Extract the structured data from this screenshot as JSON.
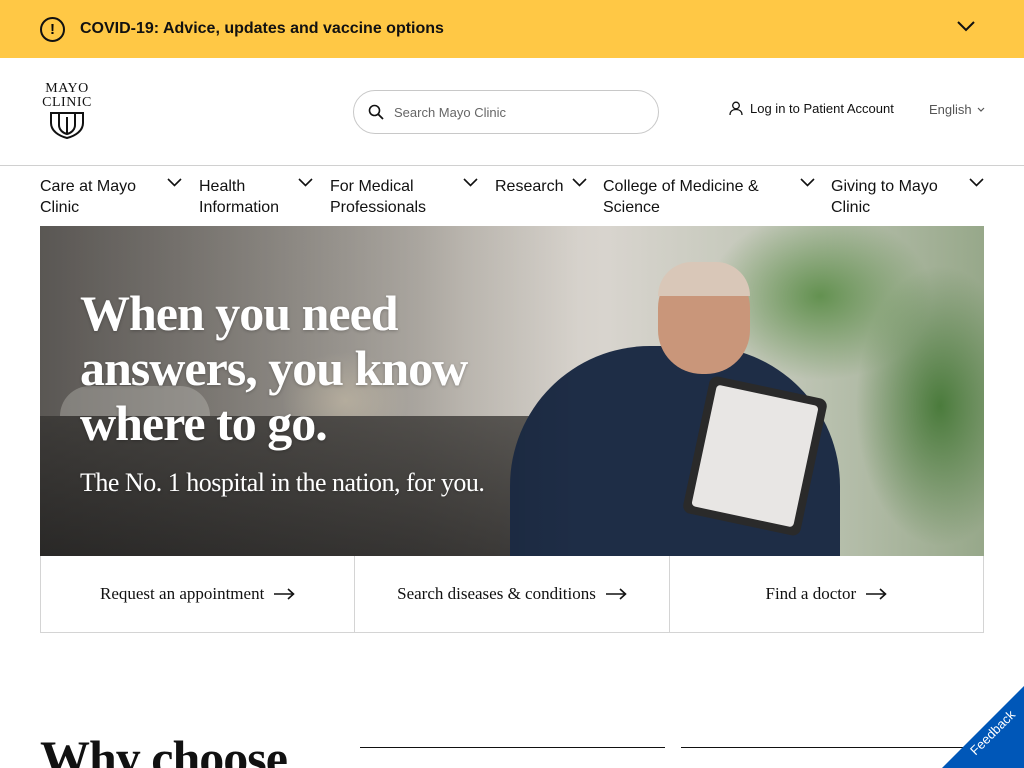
{
  "alert": {
    "icon": "exclamation-icon",
    "text": "COVID-19: Advice, updates and vaccine options",
    "accent": "#ffc845"
  },
  "header": {
    "logo": {
      "line1": "MAYO",
      "line2": "CLINIC"
    },
    "search": {
      "placeholder": "Search Mayo Clinic"
    },
    "login_label": "Log in to Patient Account",
    "language": "English"
  },
  "nav": {
    "items": [
      {
        "label": "Care at Mayo Clinic"
      },
      {
        "label": "Health Information"
      },
      {
        "label": "For Medical Professionals"
      },
      {
        "label": "Research"
      },
      {
        "label": "College of Medicine & Science"
      },
      {
        "label": "Giving to Mayo Clinic"
      }
    ]
  },
  "hero": {
    "headline": "When you need answers, you know where to go.",
    "subheadline": "The No. 1 hospital in the nation, for you."
  },
  "quick_links": [
    {
      "label": "Request an appointment"
    },
    {
      "label": "Search diseases & conditions"
    },
    {
      "label": "Find a doctor"
    }
  ],
  "section": {
    "heading": "Why choose"
  },
  "feedback": {
    "label": "Feedback",
    "color": "#0057b8"
  }
}
